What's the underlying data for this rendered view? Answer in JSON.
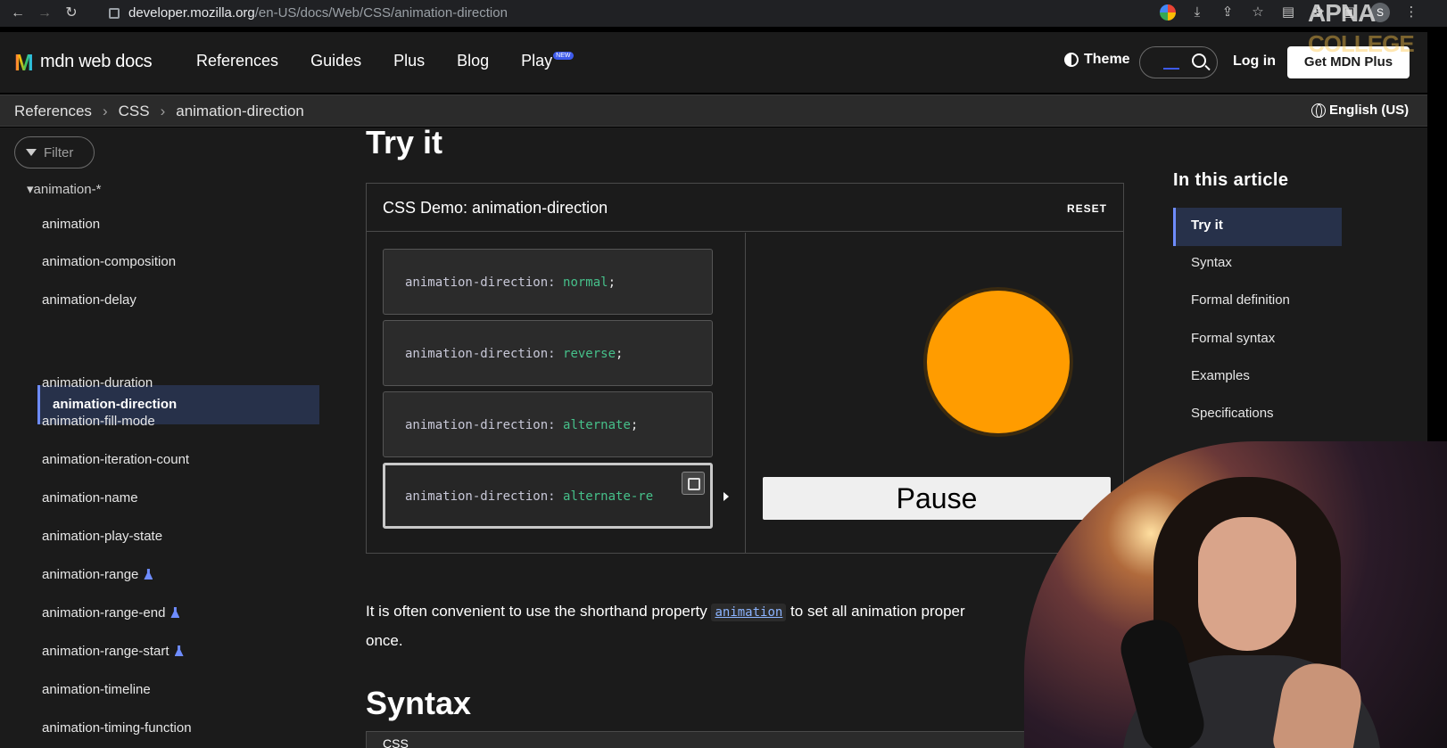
{
  "browser": {
    "url_host": "developer.mozilla.org",
    "url_path": "/en-US/docs/Web/CSS/animation-direction",
    "profile_initial": "S"
  },
  "header": {
    "logo_text": "mdn web docs",
    "nav": [
      "References",
      "Guides",
      "Plus",
      "Blog",
      "Play"
    ],
    "play_badge": "NEW",
    "theme_label": "Theme",
    "login_label": "Log in",
    "get_plus_label": "Get MDN Plus",
    "watermark_top": "APNA",
    "watermark_bottom": "COLLEGE"
  },
  "breadcrumb": {
    "items": [
      "References",
      "CSS",
      "animation-direction"
    ],
    "separator": "›",
    "language": "English (US)"
  },
  "sidebar": {
    "filter_placeholder": "Filter",
    "group": "▾animation-*",
    "items": [
      {
        "label": "animation"
      },
      {
        "label": "animation-composition"
      },
      {
        "label": "animation-delay"
      },
      {
        "label": "animation-direction",
        "active": true
      },
      {
        "label": "animation-duration"
      },
      {
        "label": "animation-fill-mode"
      },
      {
        "label": "animation-iteration-count"
      },
      {
        "label": "animation-name"
      },
      {
        "label": "animation-play-state"
      },
      {
        "label": "animation-range",
        "experimental": true
      },
      {
        "label": "animation-range-end",
        "experimental": true
      },
      {
        "label": "animation-range-start",
        "experimental": true
      },
      {
        "label": "animation-timeline"
      },
      {
        "label": "animation-timing-function"
      }
    ]
  },
  "main": {
    "try_heading": "Try it",
    "demo": {
      "title": "CSS Demo: animation-direction",
      "reset_label": "RESET",
      "property": "animation-direction:",
      "options": [
        {
          "value": "normal",
          "suffix": ";"
        },
        {
          "value": "reverse",
          "suffix": ";"
        },
        {
          "value": "alternate",
          "suffix": ";"
        },
        {
          "value": "alternate-re",
          "suffix": ""
        }
      ],
      "pause_label": "Pause",
      "ball_color": "#ff9c00"
    },
    "paragraph_before": "It is often convenient to use the shorthand property ",
    "paragraph_code": "animation",
    "paragraph_after": " to set all animation proper",
    "paragraph_line2": "once.",
    "syntax_heading": "Syntax",
    "code_tab_label": "CSS"
  },
  "toc": {
    "heading": "In this article",
    "items": [
      "Try it",
      "Syntax",
      "Formal definition",
      "Formal syntax",
      "Examples",
      "Specifications"
    ]
  },
  "colors": {
    "accent": "#6e8cff",
    "code_value": "#46c08a"
  }
}
